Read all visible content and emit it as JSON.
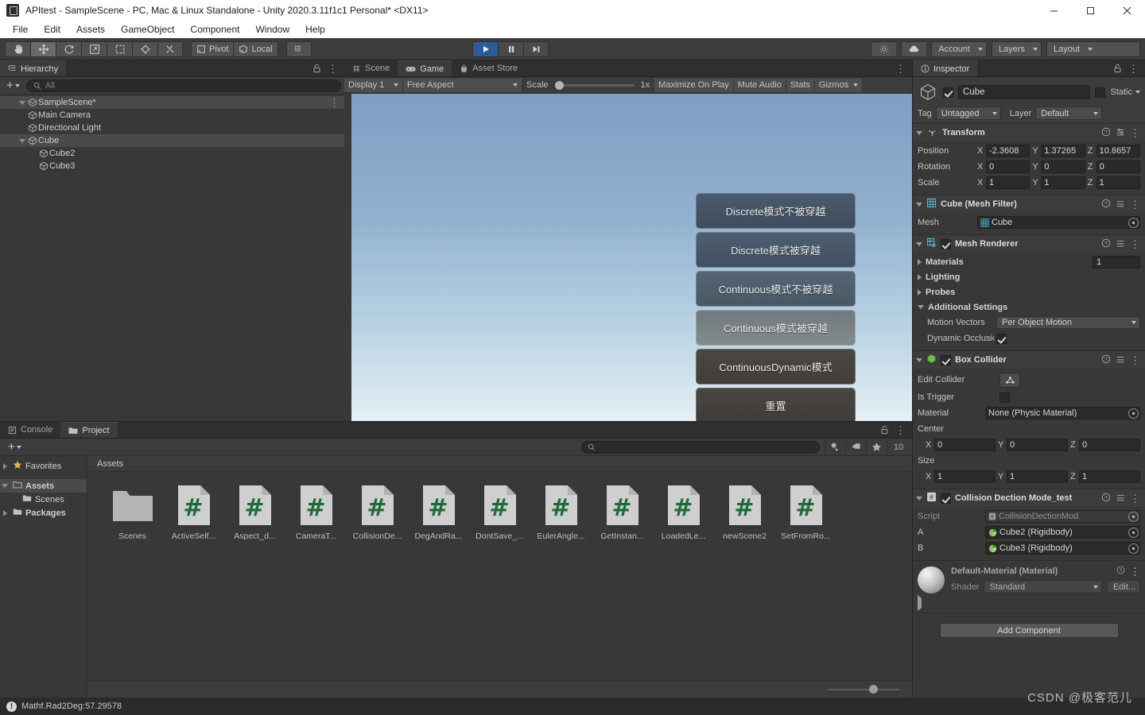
{
  "window": {
    "title": "APItest - SampleScene - PC, Mac & Linux Standalone - Unity 2020.3.11f1c1 Personal* <DX11>",
    "minimize": "minimize-icon",
    "maximize": "maximize-icon",
    "close": "close-icon"
  },
  "menubar": {
    "items": [
      "File",
      "Edit",
      "Assets",
      "GameObject",
      "Component",
      "Window",
      "Help"
    ]
  },
  "toolbar": {
    "tools": [
      "hand-tool",
      "move-tool",
      "rotate-tool",
      "scale-tool",
      "rect-tool",
      "transform-tool",
      "custom-tool"
    ],
    "pivot_label": "Pivot",
    "local_label": "Local",
    "grid_label": "grid-snap",
    "play_label": "play",
    "pause_label": "pause",
    "step_label": "step",
    "collab_label": "cloud-icon",
    "services_label": "services-icon",
    "account_label": "Account",
    "layers_label": "Layers",
    "layout_label": "Layout"
  },
  "hierarchy": {
    "tab": "Hierarchy",
    "search_placeholder": "All",
    "items": [
      {
        "label": "SampleScene*",
        "depth": 0,
        "icon": "scene-icon",
        "expanded": true,
        "selected": false
      },
      {
        "label": "Main Camera",
        "depth": 1,
        "icon": "gameobject-icon",
        "expanded": null,
        "selected": false
      },
      {
        "label": "Directional Light",
        "depth": 1,
        "icon": "gameobject-icon",
        "expanded": null,
        "selected": false
      },
      {
        "label": "Cube",
        "depth": 1,
        "icon": "gameobject-icon",
        "expanded": true,
        "selected": true
      },
      {
        "label": "Cube2",
        "depth": 2,
        "icon": "gameobject-icon",
        "expanded": null,
        "selected": false
      },
      {
        "label": "Cube3",
        "depth": 2,
        "icon": "gameobject-icon",
        "expanded": null,
        "selected": false
      }
    ]
  },
  "gameview": {
    "tabs": [
      {
        "label": "Scene",
        "icon": "scene-tab-icon",
        "active": false
      },
      {
        "label": "Game",
        "icon": "game-tab-icon",
        "active": true
      },
      {
        "label": "Asset Store",
        "icon": "asset-store-icon",
        "active": false
      }
    ],
    "display": "Display 1",
    "aspect": "Free Aspect",
    "scale_label": "Scale",
    "scale_value": "1x",
    "maximize_on_play": "Maximize On Play",
    "mute_audio": "Mute Audio",
    "stats": "Stats",
    "gizmos": "Gizmos",
    "buttons": [
      "Discrete模式不被穿越",
      "Discrete模式被穿越",
      "Continuous模式不被穿越",
      "Continuous模式被穿越",
      "ContinuousDynamic模式",
      "重置"
    ]
  },
  "project": {
    "tabs": [
      {
        "label": "Console",
        "icon": "console-icon",
        "active": false
      },
      {
        "label": "Project",
        "icon": "project-folder-icon",
        "active": true
      }
    ],
    "search_placeholder": "",
    "hidden_count": "10",
    "breadcrumb": "Assets",
    "tree": [
      {
        "label": "Favorites",
        "icon": "star-icon",
        "depth": 0,
        "expanded": false,
        "selected": false
      },
      {
        "label": "Assets",
        "icon": "folder-open-icon",
        "depth": 0,
        "expanded": true,
        "selected": true
      },
      {
        "label": "Scenes",
        "icon": "folder-icon",
        "depth": 1,
        "expanded": null,
        "selected": false
      },
      {
        "label": "Packages",
        "icon": "folder-icon",
        "depth": 0,
        "expanded": false,
        "selected": false
      }
    ],
    "assets": [
      {
        "name": "Scenes",
        "type": "folder"
      },
      {
        "name": "ActiveSelf...",
        "type": "script"
      },
      {
        "name": "Aspect_d...",
        "type": "script"
      },
      {
        "name": "CameraT...",
        "type": "script"
      },
      {
        "name": "CollisionDe...",
        "type": "script"
      },
      {
        "name": "DegAndRa...",
        "type": "script"
      },
      {
        "name": "DontSave_...",
        "type": "script"
      },
      {
        "name": "EulerAngle...",
        "type": "script"
      },
      {
        "name": "GetInstan...",
        "type": "script"
      },
      {
        "name": "LoadedLe...",
        "type": "script"
      },
      {
        "name": "newScene2",
        "type": "script"
      },
      {
        "name": "SetFromRo...",
        "type": "script"
      }
    ]
  },
  "inspector": {
    "tab": "Inspector",
    "object_name": "Cube",
    "object_enabled": true,
    "static_label": "Static",
    "tag_label": "Tag",
    "tag_value": "Untagged",
    "layer_label": "Layer",
    "layer_value": "Default",
    "components": [
      {
        "title": "Transform",
        "icon": "transform-icon",
        "rows": [
          {
            "label": "Position",
            "x": "-2.3608",
            "y": "1.37265",
            "z": "10.8657"
          },
          {
            "label": "Rotation",
            "x": "0",
            "y": "0",
            "z": "0"
          },
          {
            "label": "Scale",
            "x": "1",
            "y": "1",
            "z": "1"
          }
        ]
      },
      {
        "title": "Cube (Mesh Filter)",
        "icon": "mesh-filter-icon",
        "mesh_label": "Mesh",
        "mesh_value": "Cube"
      },
      {
        "title": "Mesh Renderer",
        "icon": "mesh-renderer-icon",
        "folds": [
          "Materials",
          "Lighting",
          "Probes",
          "Additional Settings"
        ],
        "materials_count": "1",
        "motion_vectors_label": "Motion Vectors",
        "motion_vectors_value": "Per Object Motion",
        "dynamic_occlusion_label": "Dynamic Occlusion"
      },
      {
        "title": "Box Collider",
        "icon": "box-collider-icon",
        "edit_collider_label": "Edit Collider",
        "is_trigger_label": "Is Trigger",
        "material_label": "Material",
        "material_value": "None (Physic Material)",
        "center_label": "Center",
        "center": {
          "x": "0",
          "y": "0",
          "z": "0"
        },
        "size_label": "Size",
        "size": {
          "x": "1",
          "y": "1",
          "z": "1"
        }
      },
      {
        "title": "Collision Dection Mode_test",
        "icon": "script-icon",
        "script_label": "Script",
        "script_value": "CollisionDectionMod",
        "a_label": "A",
        "a_value": "Cube2 (Rigidbody)",
        "b_label": "B",
        "b_value": "Cube3 (Rigidbody)"
      }
    ],
    "material": {
      "title": "Default-Material (Material)",
      "shader_label": "Shader",
      "shader_value": "Standard",
      "edit_label": "Edit..."
    },
    "add_component": "Add Component"
  },
  "statusbar": {
    "message": "Mathf.Rad2Deg:57.29578"
  },
  "watermark": "CSDN @极客范儿",
  "colors": {
    "accent_blue": "#2b5c96",
    "panel_bg": "#383838",
    "toolbar_bg": "#3c3c3c",
    "selection": "#4a4a4a",
    "script_green": "#1f6b38"
  }
}
